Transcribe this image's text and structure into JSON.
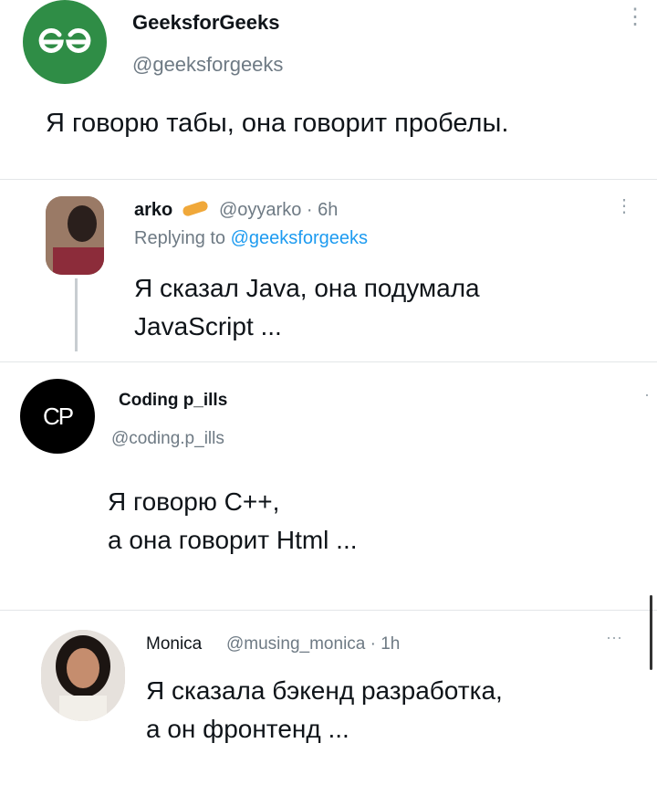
{
  "tweets": [
    {
      "name": "GeeksforGeeks",
      "handle": "@geeksforgeeks",
      "text": "Я говорю табы, она говорит пробелы."
    },
    {
      "name": "arko",
      "handle": "@oyyarko · 6h",
      "replying_prefix": "Replying to ",
      "replying_handle": "@geeksforgeeks",
      "text_line1": "Я сказал Java, она подумала",
      "text_line2": "JavaScript ..."
    },
    {
      "name": "Coding p_ills",
      "handle": "@coding.p_ills",
      "avatar_text": "CP",
      "text_line1": "Я говорю C++,",
      "text_line2": "а она говорит Html ..."
    },
    {
      "name": "Monica",
      "handle": "@musing_monica · 1h",
      "text_line1": "Я сказала бэкенд разработка,",
      "text_line2": "а он фронтенд ..."
    }
  ],
  "colors": {
    "gfg_green": "#2f8d46",
    "link_blue": "#1d9bf0",
    "handle_gray": "#6e7a84"
  },
  "icons": {
    "gfg_logo": "gfg-logo-icon",
    "more": "more-vertical-icon",
    "more_h": "more-horizontal-icon"
  }
}
